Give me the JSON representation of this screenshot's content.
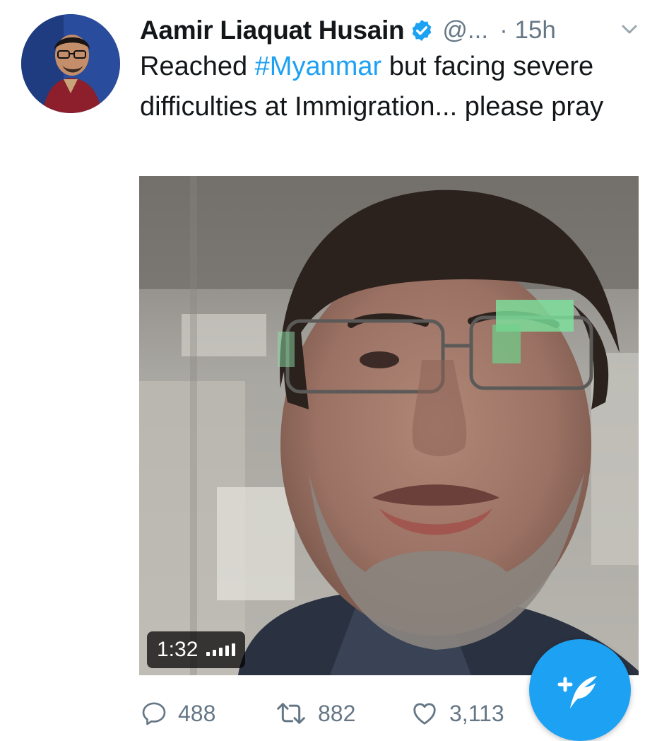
{
  "tweet": {
    "author_name": "Aamir Liaquat Husain",
    "author_handle": "@...",
    "time_prefix": "·",
    "time": "15h",
    "text_before_tag": "Reached ",
    "hashtag": "#Myanmar",
    "text_after_tag": " but facing severe difficulties at Immigration... please pray"
  },
  "media": {
    "duration": "1:32"
  },
  "actions": {
    "replies": "488",
    "retweets": "882",
    "likes": "3,113"
  },
  "colors": {
    "accent": "#1da1f2",
    "secondary_text": "#657786",
    "primary_text": "#14171a"
  },
  "icons": {
    "verified": "verified-badge-icon",
    "caret": "chevron-down-icon",
    "reply": "reply-icon",
    "retweet": "retweet-icon",
    "like": "heart-icon",
    "compose": "compose-tweet-icon"
  }
}
